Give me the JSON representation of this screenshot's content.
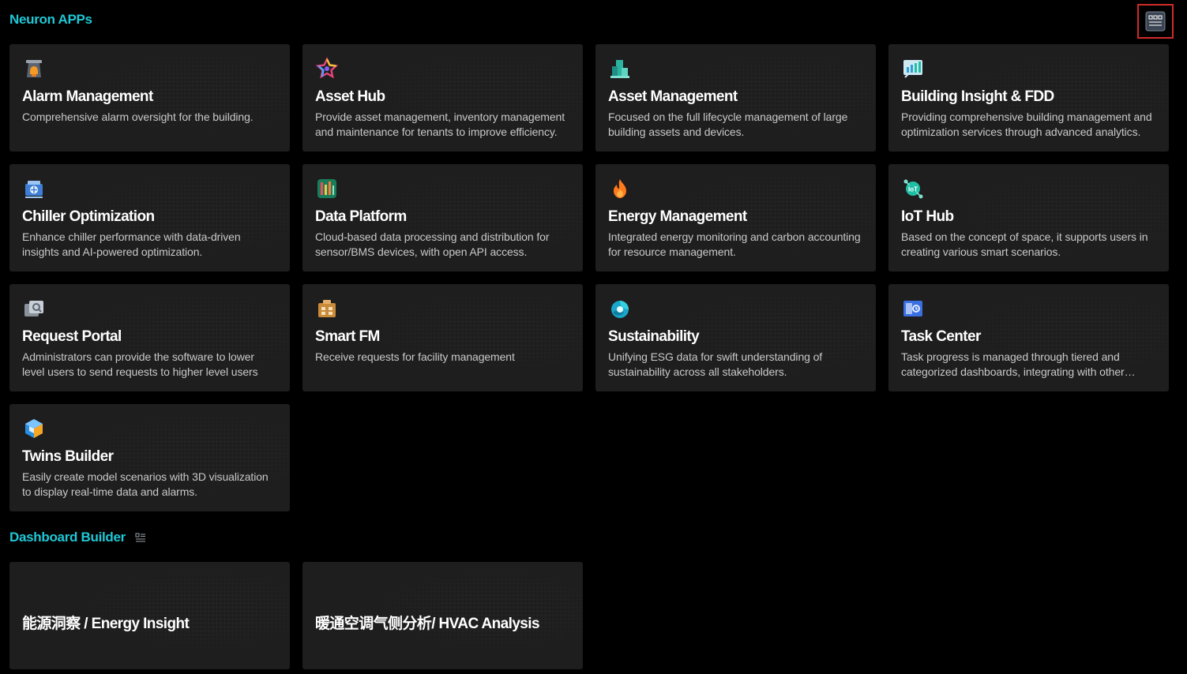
{
  "header": {
    "title": "Neuron APPs"
  },
  "apps": [
    {
      "title": "Alarm Management",
      "desc": "Comprehensive alarm oversight for the building.",
      "icon": "alarm-icon"
    },
    {
      "title": "Asset Hub",
      "desc": "Provide asset management, inventory management and maintenance for tenants to improve efficiency.",
      "icon": "star-hub-icon"
    },
    {
      "title": "Asset Management",
      "desc": "Focused on the full lifecycle management of large building assets and devices.",
      "icon": "building-asset-icon"
    },
    {
      "title": "Building Insight & FDD",
      "desc": "Providing comprehensive building management and optimization services through advanced analytics.",
      "icon": "chart-insight-icon"
    },
    {
      "title": "Chiller Optimization",
      "desc": "Enhance chiller performance with data-driven insights and AI-powered optimization.",
      "icon": "chiller-icon"
    },
    {
      "title": "Data Platform",
      "desc": "Cloud-based data processing and distribution for sensor/BMS devices, with open API access.",
      "icon": "data-platform-icon"
    },
    {
      "title": "Energy Management",
      "desc": "Integrated energy monitoring and carbon accounting for resource management.",
      "icon": "flame-icon"
    },
    {
      "title": "IoT Hub",
      "desc": "Based on the concept of space, it supports users in creating various smart scenarios.",
      "icon": "iot-icon"
    },
    {
      "title": "Request Portal",
      "desc": "Administrators can provide the software to lower level users to send requests to higher level users",
      "icon": "request-portal-icon"
    },
    {
      "title": "Smart FM",
      "desc": "Receive requests for facility management",
      "icon": "smart-fm-icon"
    },
    {
      "title": "Sustainability",
      "desc": "Unifying ESG data for swift understanding of sustainability across all stakeholders.",
      "icon": "sustainability-icon"
    },
    {
      "title": "Task Center",
      "desc": "Task progress is managed through tiered and categorized dashboards, integrating with other systems.",
      "icon": "task-center-icon"
    },
    {
      "title": "Twins Builder",
      "desc": "Easily create model scenarios with 3D visualization to display real-time data and alarms.",
      "icon": "cube-builder-icon"
    }
  ],
  "dashboard": {
    "title": "Dashboard Builder",
    "items": [
      {
        "title": "能源洞察 / Energy Insight"
      },
      {
        "title": "暖通空调气侧分析/ HVAC Analysis"
      }
    ]
  }
}
